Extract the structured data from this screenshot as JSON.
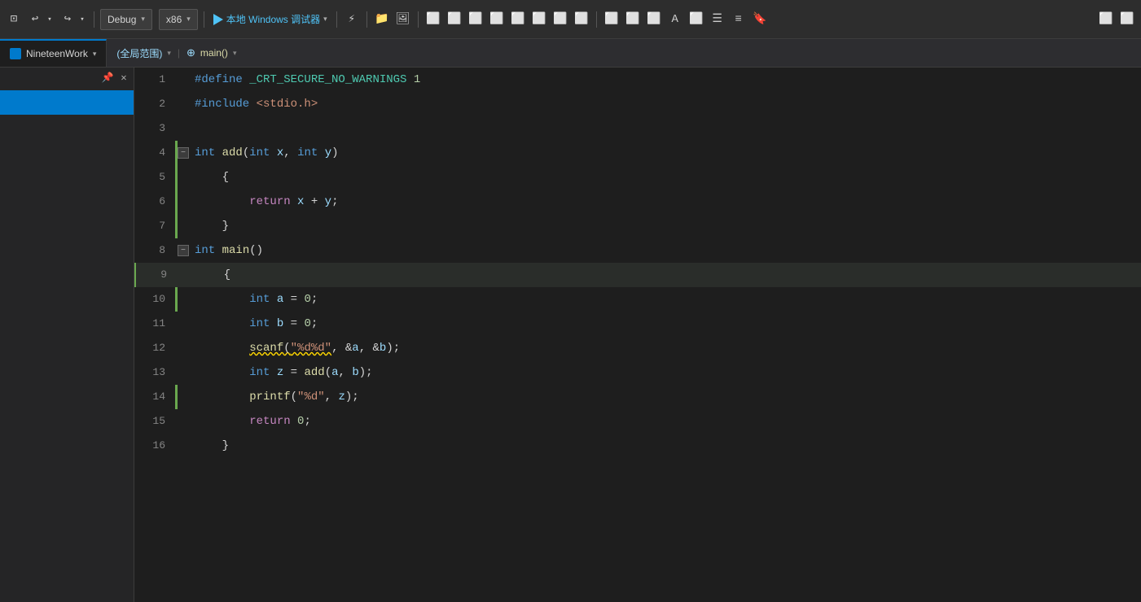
{
  "toolbar": {
    "debug_label": "Debug",
    "arch_label": "x86",
    "run_label": "本地 Windows 调试器",
    "debug_arrow": "▾",
    "arch_arrow": "▾",
    "run_arrow": "▾"
  },
  "tab": {
    "name": "NineteenWork",
    "scope": "(全局范围)",
    "scope_arrow": "▾",
    "func": "main()",
    "func_arrow": "▾"
  },
  "code": {
    "lines": [
      {
        "num": 1,
        "content": "#define _CRT_SECURE_NO_WARNINGS 1",
        "type": "normal",
        "green": false,
        "collapse": false,
        "indent": 0
      },
      {
        "num": 2,
        "content": "#include <stdio.h>",
        "type": "normal",
        "green": false,
        "collapse": false,
        "indent": 0
      },
      {
        "num": 3,
        "content": "",
        "type": "normal",
        "green": false,
        "collapse": false,
        "indent": 0
      },
      {
        "num": 4,
        "content": "int add(int x, int y)",
        "type": "normal",
        "green": true,
        "collapse": true,
        "indent": 0
      },
      {
        "num": 5,
        "content": "{",
        "type": "normal",
        "green": true,
        "collapse": false,
        "indent": 1
      },
      {
        "num": 6,
        "content": "    return x + y;",
        "type": "normal",
        "green": true,
        "collapse": false,
        "indent": 2
      },
      {
        "num": 7,
        "content": "}",
        "type": "normal",
        "green": true,
        "collapse": false,
        "indent": 1
      },
      {
        "num": 8,
        "content": "int main()",
        "type": "normal",
        "green": false,
        "collapse": true,
        "indent": 0
      },
      {
        "num": 9,
        "content": "{",
        "type": "highlighted",
        "green": false,
        "collapse": false,
        "indent": 1
      },
      {
        "num": 10,
        "content": "    int a = 0;",
        "type": "normal",
        "green": true,
        "collapse": false,
        "indent": 2
      },
      {
        "num": 11,
        "content": "    int b = 0;",
        "type": "normal",
        "green": false,
        "collapse": false,
        "indent": 2
      },
      {
        "num": 12,
        "content": "    scanf(\"%d%d\", &a, &b);",
        "type": "normal",
        "green": false,
        "collapse": false,
        "indent": 2
      },
      {
        "num": 13,
        "content": "    int z = add(a, b);",
        "type": "normal",
        "green": false,
        "collapse": false,
        "indent": 2
      },
      {
        "num": 14,
        "content": "    printf(\"%d\", z);",
        "type": "normal",
        "green": true,
        "collapse": false,
        "indent": 2
      },
      {
        "num": 15,
        "content": "    return 0;",
        "type": "normal",
        "green": false,
        "collapse": false,
        "indent": 2
      },
      {
        "num": 16,
        "content": "}",
        "type": "normal",
        "green": false,
        "collapse": false,
        "indent": 1
      }
    ]
  }
}
